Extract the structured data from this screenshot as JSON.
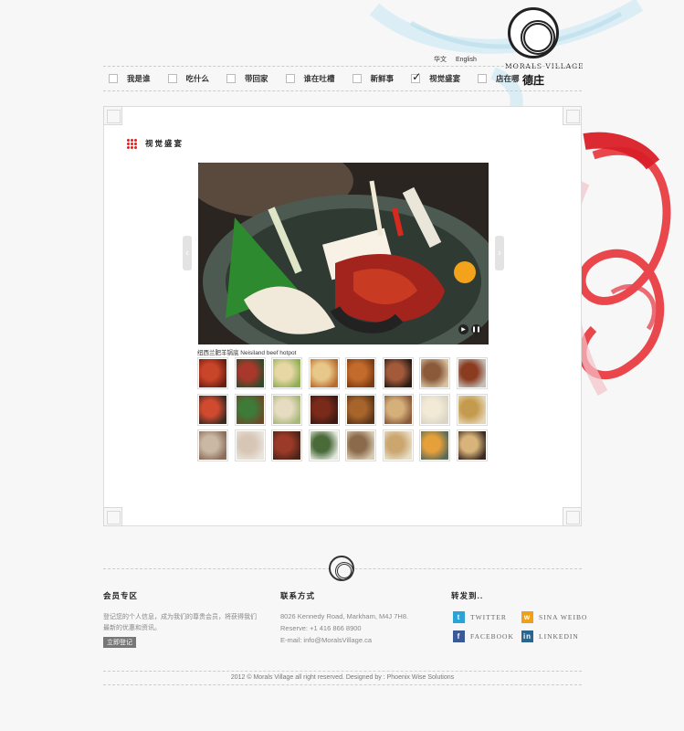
{
  "brand": {
    "logo_text": "MORALS VILLAGE",
    "logo_cn": "德庄"
  },
  "lang": {
    "cn": "华文",
    "en": "English"
  },
  "nav": {
    "items": [
      "我是谁",
      "吃什么",
      "带回家",
      "谁在吐槽",
      "新鲜事",
      "视觉盛宴",
      "店在哪"
    ],
    "active_index": 5
  },
  "main": {
    "section_title": "视觉盛宴",
    "photo_caption": "纽西兰肥羊锅底 Neisiland beef hotpot",
    "thumbnail_count": 24
  },
  "footer": {
    "member": {
      "title": "会员专区",
      "text": "登记您的个人信息，成为我们的尊贵会员，将获得我们最新的优惠和资讯。",
      "button": "立即登记"
    },
    "contact": {
      "title": "联系方式",
      "address": "8026 Kennedy Road, Markham, M4J 7H8.",
      "reserve": "Reserve: +1 416 866 8900",
      "email": "E-mail: info@MoralsVillage.ca"
    },
    "share": {
      "title": "转发到..",
      "twitter": "TWITTER",
      "sina": "SINA WEIBO",
      "facebook": "FACEBOOK",
      "linkedin": "LINKEDIN"
    },
    "copyright": "2012 © Morals Village all right reserved.   Designed by : Phoenix Wise Solutions"
  },
  "colors": {
    "accent_red": "#d22222",
    "twitter": "#2ba3d6",
    "facebook": "#3b5998",
    "linkedin": "#2a6592",
    "sina": "#f0a017"
  }
}
